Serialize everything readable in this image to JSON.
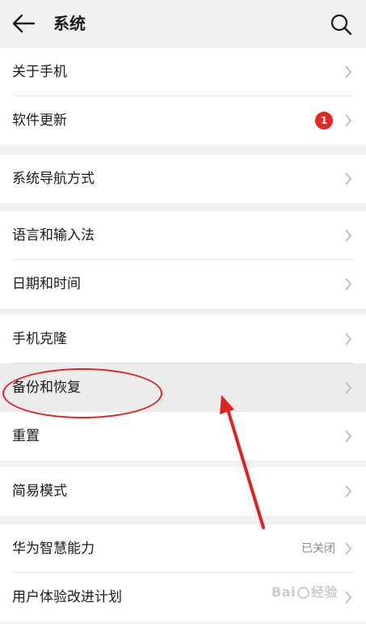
{
  "header": {
    "title": "系统",
    "back_icon": "arrow-left-icon",
    "search_icon": "search-icon"
  },
  "groups": [
    {
      "items": [
        {
          "label": "关于手机"
        },
        {
          "label": "软件更新",
          "badge": "1"
        }
      ]
    },
    {
      "items": [
        {
          "label": "系统导航方式"
        }
      ]
    },
    {
      "items": [
        {
          "label": "语言和输入法"
        },
        {
          "label": "日期和时间"
        }
      ]
    },
    {
      "items": [
        {
          "label": "手机克隆"
        },
        {
          "label": "备份和恢复"
        },
        {
          "label": "重置"
        }
      ]
    },
    {
      "items": [
        {
          "label": "简易模式"
        }
      ]
    },
    {
      "items": [
        {
          "label": "华为智慧能力",
          "value": "已关闭"
        },
        {
          "label": "用户体验改进计划"
        }
      ]
    }
  ],
  "watermark": {
    "brand": "Bai",
    "brand_suffix": "经验"
  },
  "colors": {
    "background": "#f1f1f1",
    "row_background": "#ffffff",
    "badge": "#e8251f",
    "annotation": "#e3221c"
  }
}
